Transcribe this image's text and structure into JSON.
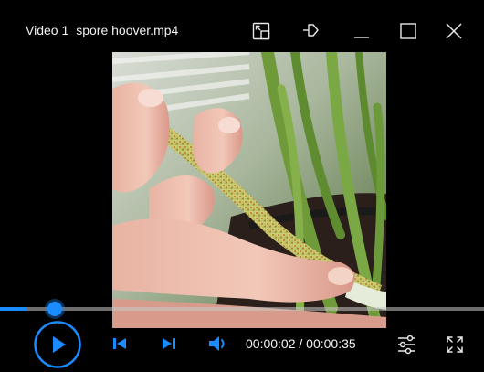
{
  "window": {
    "title_prefix": "Video 1",
    "file_name": "spore hoover.mp4"
  },
  "titlebar_buttons": [
    {
      "name": "compact-overlay-icon"
    },
    {
      "name": "pin-icon"
    },
    {
      "name": "minimize-icon"
    },
    {
      "name": "maximize-icon"
    },
    {
      "name": "close-icon"
    }
  ],
  "playback": {
    "current_time": "00:00:02",
    "separator": " / ",
    "total_time": "00:00:35",
    "progress_fraction": 0.057
  },
  "controls": {
    "play_icon": "play-icon",
    "previous_icon": "skip-previous-icon",
    "next_icon": "skip-next-icon",
    "volume_icon": "volume-icon",
    "settings_icon": "settings-sliders-icon",
    "fullscreen_icon": "fullscreen-icon"
  },
  "colors": {
    "accent": "#1a8cff",
    "background": "#000000",
    "text": "#f2f2f2"
  }
}
